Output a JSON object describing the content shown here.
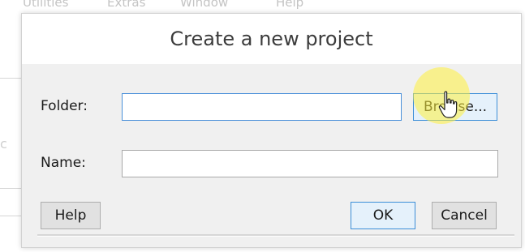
{
  "background_menu": {
    "items": [
      "Utilities",
      "Extras",
      "Window",
      "Help"
    ]
  },
  "dialog": {
    "title": "Create a new project",
    "folder_label": "Folder:",
    "folder_value": "",
    "browse_label": "Browse...",
    "name_label": "Name:",
    "name_value": "",
    "help_label": "Help",
    "ok_label": "OK",
    "cancel_label": "Cancel"
  },
  "cursor": {
    "icon": "hand-pointer-icon",
    "highlight_color": "#fff03c"
  },
  "colors": {
    "accent": "#3c8ed8",
    "dialog_bg": "#f0f0f0"
  }
}
